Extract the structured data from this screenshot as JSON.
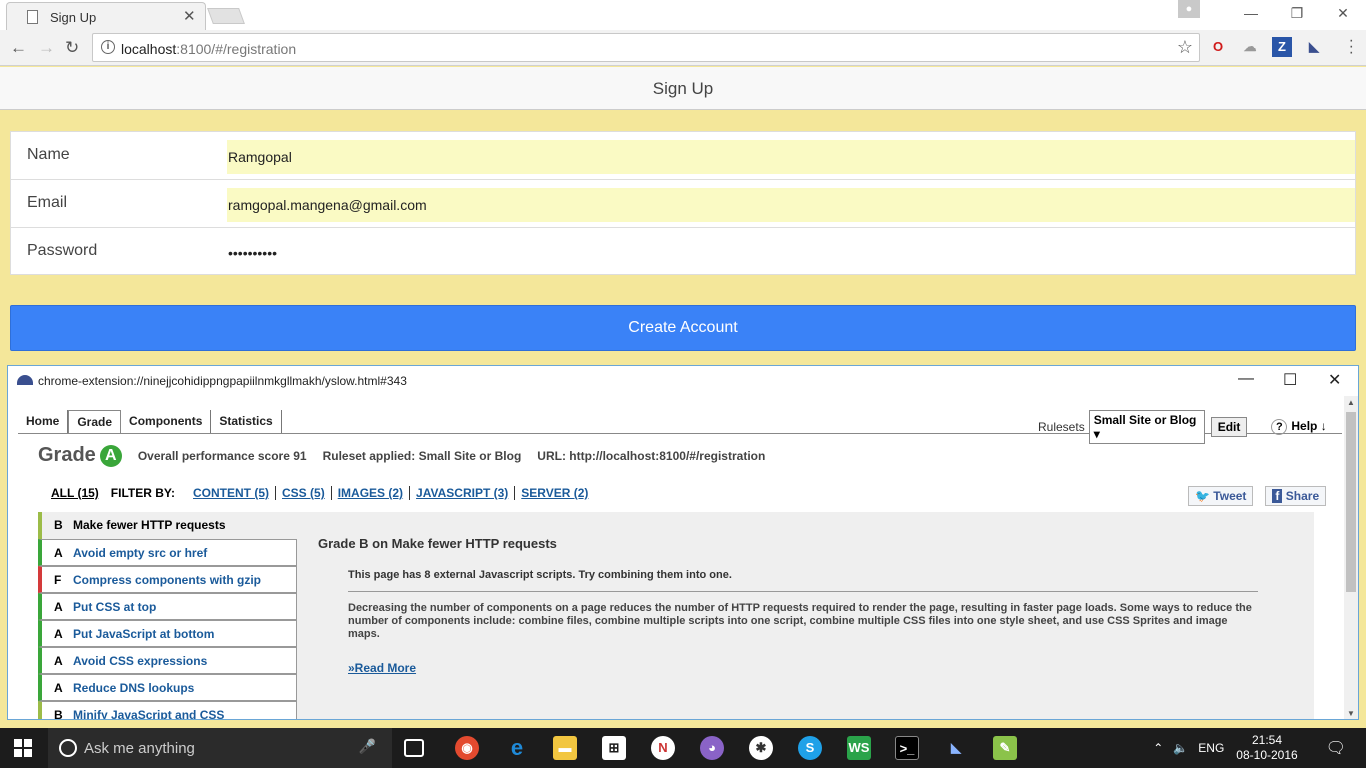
{
  "browser": {
    "tab_title": "Sign Up",
    "tab_close": "✕",
    "url_host": "localhost",
    "url_rest": ":8100/#/registration",
    "profile_icon": "person-icon"
  },
  "app": {
    "header_title": "Sign Up",
    "fields": [
      {
        "label": "Name",
        "value": "Ramgopal"
      },
      {
        "label": "Email",
        "value": "ramgopal.mangena@gmail.com"
      },
      {
        "label": "Password",
        "value": "••••••••••"
      }
    ],
    "create_button": "Create Account"
  },
  "yslow": {
    "window_url": "chrome-extension://ninejjcohidippngpapiilnmkgllmakh/yslow.html#343",
    "nav": [
      "Home",
      "Grade",
      "Components",
      "Statistics"
    ],
    "active_nav": "Grade",
    "rulesets_label": "Rulesets",
    "ruleset_value": "Small Site or Blog",
    "edit_label": "Edit",
    "help_label": "Help ↓",
    "grade_label": "Grade",
    "grade": "A",
    "score_text": "Overall performance score 91",
    "ruleset_text": "Ruleset applied: Small Site or Blog",
    "url_text": "URL: http://localhost:8100/#/registration",
    "filter_all": "ALL (15)",
    "filter_by": "FILTER BY:",
    "filters": [
      "CONTENT (5)",
      "CSS (5)",
      "IMAGES (2)",
      "JAVASCRIPT (3)",
      "SERVER (2)"
    ],
    "tweet": "Tweet",
    "share": "Share",
    "rules": [
      {
        "grade": "B",
        "name": "Make fewer HTTP requests"
      },
      {
        "grade": "A",
        "name": "Avoid empty src or href"
      },
      {
        "grade": "F",
        "name": "Compress components with gzip"
      },
      {
        "grade": "A",
        "name": "Put CSS at top"
      },
      {
        "grade": "A",
        "name": "Put JavaScript at bottom"
      },
      {
        "grade": "A",
        "name": "Avoid CSS expressions"
      },
      {
        "grade": "A",
        "name": "Reduce DNS lookups"
      },
      {
        "grade": "B",
        "name": "Minify JavaScript and CSS"
      }
    ],
    "detail_title": "Grade B on Make fewer HTTP requests",
    "detail_msg": "This page has 8 external Javascript scripts. Try combining them into one.",
    "detail_desc": "Decreasing the number of components on a page reduces the number of HTTP requests required to render the page, resulting in faster page loads. Some ways to reduce the number of components include: combine files, combine multiple scripts into one script, combine multiple CSS files into one style sheet, and use CSS Sprites and image maps.",
    "read_more": "»Read More"
  },
  "taskbar": {
    "search_placeholder": "Ask me anything",
    "language": "ENG",
    "time": "21:54",
    "date": "08-10-2016"
  }
}
